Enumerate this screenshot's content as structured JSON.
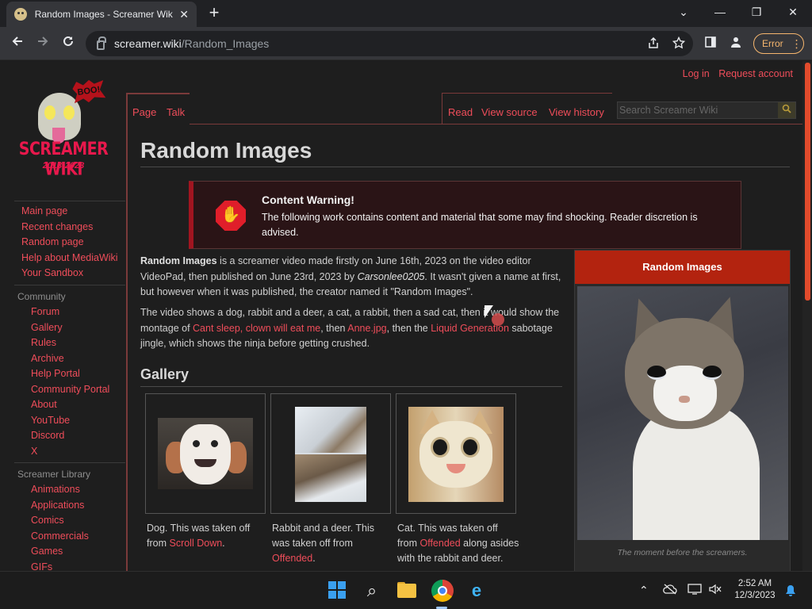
{
  "browser": {
    "tab_title": "Random Images - Screamer Wiki",
    "tab_close": "✕",
    "new_tab": "+",
    "win_min": "—",
    "win_max": "❐",
    "win_close": "✕",
    "win_dropdown": "⌄",
    "url_host": "screamer.wiki",
    "url_path": "/Random_Images",
    "error_label": "Error",
    "icons": [
      "back-icon",
      "forward-icon",
      "reload-icon",
      "lock-icon",
      "share-icon",
      "star-icon",
      "side-panel-icon",
      "profile-icon",
      "menu-dots-icon"
    ]
  },
  "wiki": {
    "logo_text": "SCREAMER WIKI",
    "logo_years": "2013-2023",
    "logo_boo": "BOO!",
    "usermenu": {
      "login": "Log in",
      "request": "Request account"
    },
    "tabs": {
      "page": "Page",
      "talk": "Talk",
      "read": "Read",
      "view_source": "View source",
      "view_history": "View history"
    },
    "search_placeholder": "Search Screamer Wiki",
    "nav": [
      "Main page",
      "Recent changes",
      "Random page",
      "Help about MediaWiki",
      "Your Sandbox"
    ],
    "community_heading": "Community",
    "community": [
      "Forum",
      "Gallery",
      "Rules",
      "Archive",
      "Help Portal",
      "Community Portal",
      "About",
      "YouTube",
      "Discord",
      "X"
    ],
    "library_heading": "Screamer Library",
    "library": [
      "Animations",
      "Applications",
      "Comics",
      "Commercials",
      "Games",
      "GIFs"
    ]
  },
  "article": {
    "title": "Random Images",
    "warning_title": "Content Warning!",
    "warning_text": "The following work contains content and material that some may find shocking. Reader discretion is advised.",
    "p1": {
      "bold": "Random Images",
      "t1": " is a screamer video made firstly on June 16th, 2023 on the video editor VideoPad, then published on June 23rd, 2023 by ",
      "author": "Carsonlee0205",
      "t2": ". It wasn't given a name at first, but however when it was published, the creator named it \"Random Images\"."
    },
    "p2": {
      "t1": "The video shows a dog, rabbit and a deer, a cat, a rabbit, then a sad cat, then it would show the montage of ",
      "link1": "Cant sleep, clown will eat me",
      "t2": ", then ",
      "link2": "Anne.jpg",
      "t3": ", then the ",
      "link3": "Liquid Generation",
      "t4": " sabotage jingle, which shows the ninja before getting crushed."
    },
    "gallery_heading": "Gallery",
    "gallery": [
      {
        "t1": "Dog. This was taken off from ",
        "link": "Scroll Down",
        "t2": "."
      },
      {
        "t1": "Rabbit and a deer. This was taken off from ",
        "link": "Offended",
        "t2": "."
      },
      {
        "t1": "Cat. This was taken off from ",
        "link": "Offended",
        "t2": " along asides with the rabbit and deer."
      }
    ],
    "infobox": {
      "title": "Random Images",
      "caption": "The moment before the screamers."
    }
  },
  "taskbar": {
    "time": "2:52 AM",
    "date": "12/3/2023",
    "tray_chevron": "⌃",
    "search_glyph": "⌕",
    "ie_glyph": "e",
    "bell": "🔔"
  },
  "colors": {
    "link": "#ef4d5a",
    "accent_red": "#b3230f",
    "warning_bar": "#a11520",
    "error_badge": "#f6b66e"
  }
}
